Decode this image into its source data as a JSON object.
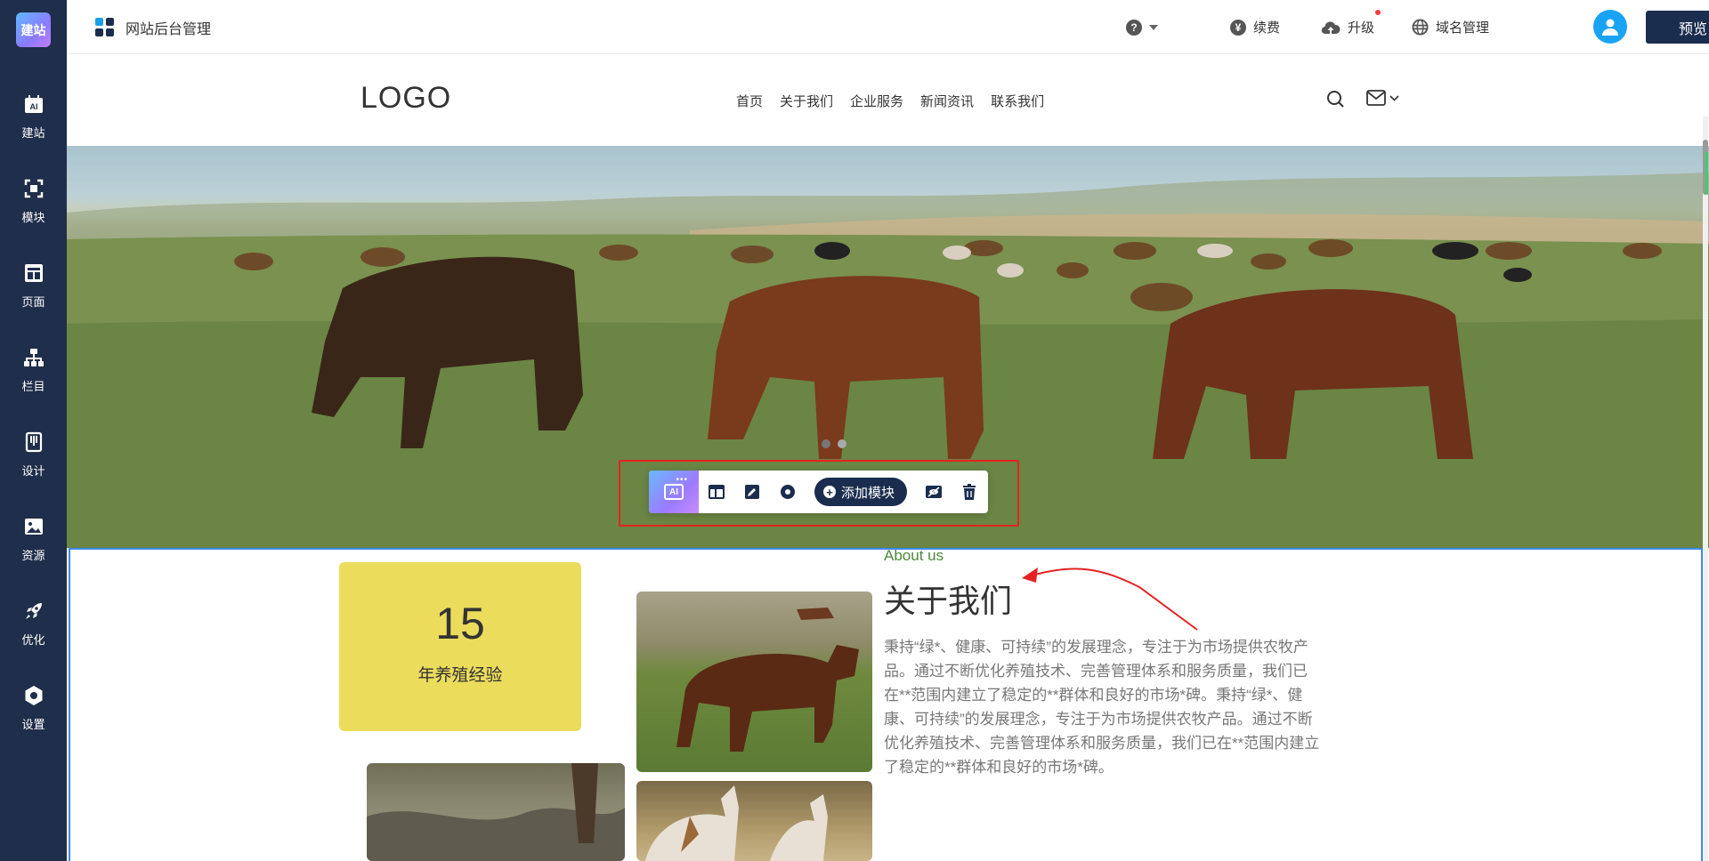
{
  "sidebar": {
    "brand": "建站",
    "items": [
      {
        "label": "建站",
        "icon": "ai-build-icon"
      },
      {
        "label": "模块",
        "icon": "module-icon"
      },
      {
        "label": "页面",
        "icon": "page-icon"
      },
      {
        "label": "栏目",
        "icon": "column-tree-icon"
      },
      {
        "label": "设计",
        "icon": "design-icon"
      },
      {
        "label": "资源",
        "icon": "resource-image-icon"
      },
      {
        "label": "优化",
        "icon": "rocket-icon"
      },
      {
        "label": "设置",
        "icon": "settings-icon"
      }
    ]
  },
  "topbar": {
    "title": "网站后台管理",
    "help": "?",
    "renew": "续费",
    "upgrade": "升级",
    "domain": "域名管理",
    "preview": "预览"
  },
  "site": {
    "logo": "LOGO",
    "nav": [
      "首页",
      "关于我们",
      "企业服务",
      "新闻资讯",
      "联系我们"
    ]
  },
  "toolbar": {
    "ai_label": "AI",
    "add_module": "添加模块"
  },
  "about": {
    "years": "15",
    "years_caption": "年养殖经验",
    "subtitle": "About us",
    "title": "关于我们",
    "body": "秉持“绿*、健康、可持续”的发展理念，专注于为市场提供农牧产品。通过不断优化养殖技术、完善管理体系和服务质量，我们已在**范围内建立了稳定的**群体和良好的市场*碑。秉持“绿*、健康、可持续”的发展理念，专注于为市场提供农牧产品。通过不断优化养殖技术、完善管理体系和服务质量，我们已在**范围内建立了稳定的**群体和良好的市场*碑。"
  },
  "colors": {
    "sidebar_bg": "#1f2e4a",
    "primary_dark": "#1a2d4e",
    "accent_yellow": "#ebdc5c",
    "highlight_red": "#e52222",
    "selection_blue": "#3b8bea",
    "avatar_blue": "#18a3f5"
  }
}
